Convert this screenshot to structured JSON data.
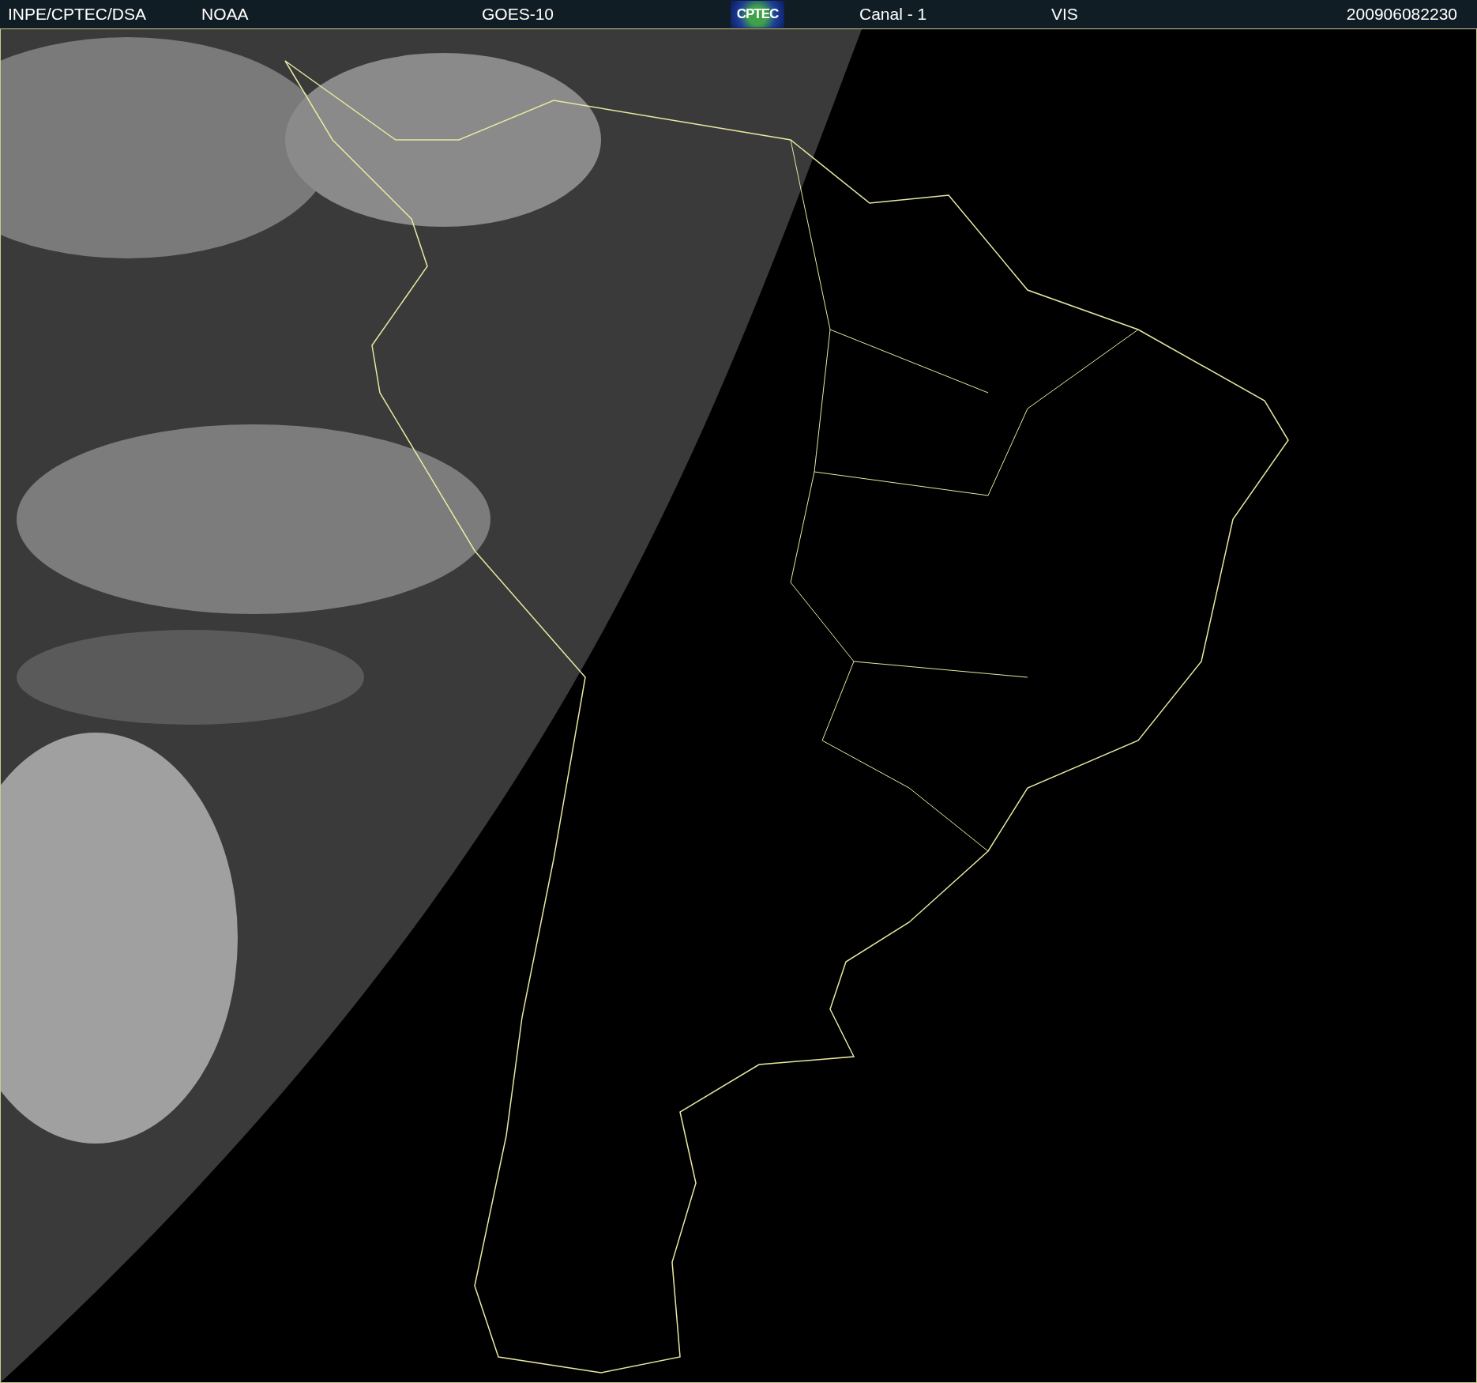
{
  "header": {
    "items": [
      {
        "kind": "text",
        "text": "INPE/CPTEC/DSA"
      },
      {
        "kind": "text",
        "text": "NOAA"
      },
      {
        "kind": "text",
        "text": "GOES-10"
      },
      {
        "kind": "logo",
        "text": "CPTEC"
      },
      {
        "kind": "text",
        "text": "Canal - 1"
      },
      {
        "kind": "text",
        "text": "VIS"
      },
      {
        "kind": "text",
        "text": "200906082230"
      }
    ]
  }
}
